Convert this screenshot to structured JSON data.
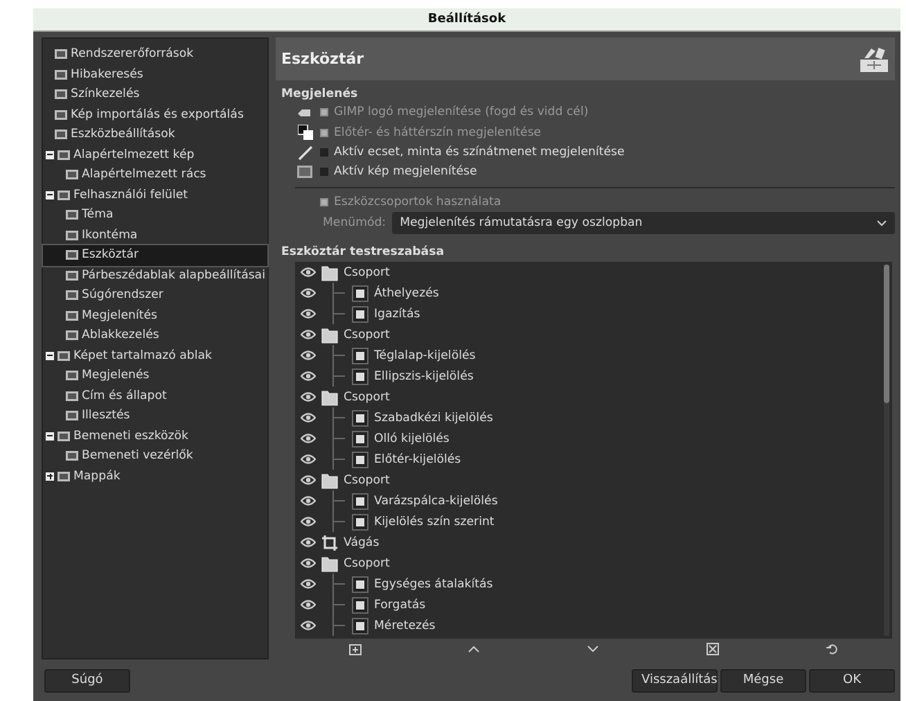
{
  "window": {
    "title": "Beállítások"
  },
  "sidebar": {
    "items": [
      {
        "label": "Rendszererőforrások",
        "selected": false
      },
      {
        "label": "Hibakeresés",
        "selected": false
      },
      {
        "label": "Színkezelés",
        "selected": false
      },
      {
        "label": "Kép importálás és exportálás",
        "selected": false
      },
      {
        "label": "Eszközbeállítások",
        "selected": false
      },
      {
        "label": "Alapértelmezett kép",
        "selected": false,
        "expanded": true,
        "children": [
          {
            "label": "Alapértelmezett rács",
            "selected": false
          }
        ]
      },
      {
        "label": "Felhasználói felület",
        "selected": false,
        "expanded": true,
        "children": [
          {
            "label": "Téma",
            "selected": false
          },
          {
            "label": "Ikontéma",
            "selected": false
          },
          {
            "label": "Eszköztár",
            "selected": true
          },
          {
            "label": "Párbeszédablak alapbeállításai",
            "selected": false
          },
          {
            "label": "Súgórendszer",
            "selected": false
          },
          {
            "label": "Megjelenítés",
            "selected": false
          },
          {
            "label": "Ablakkezelés",
            "selected": false
          }
        ]
      },
      {
        "label": "Képet tartalmazó ablak",
        "selected": false,
        "expanded": true,
        "children": [
          {
            "label": "Megjelenés",
            "selected": false
          },
          {
            "label": "Cím és állapot",
            "selected": false
          },
          {
            "label": "Illesztés",
            "selected": false
          }
        ]
      },
      {
        "label": "Bemeneti eszközök",
        "selected": false,
        "expanded": true,
        "children": [
          {
            "label": "Bemeneti vezérlők",
            "selected": false
          }
        ]
      },
      {
        "label": "Mappák",
        "selected": false,
        "expanded": false
      }
    ]
  },
  "page": {
    "title": "Eszköztár",
    "appearance": {
      "heading": "Megjelenés",
      "options": [
        {
          "label": "GIMP logó megjelenítése (fogd és vidd cél)",
          "checked": true,
          "disabled": true
        },
        {
          "label": "Előtér- és háttérszín megjelenítése",
          "checked": true,
          "disabled": true
        },
        {
          "label": "Aktív ecset, minta és színátmenet megjelenítése",
          "checked": false,
          "disabled": false
        },
        {
          "label": "Aktív kép megjelenítése",
          "checked": false,
          "disabled": false
        }
      ]
    },
    "groups_option": {
      "label": "Eszközcsoportok használata",
      "checked": true,
      "disabled": true
    },
    "menu_mode": {
      "label": "Menümód:",
      "value": "Megjelenítés rámutatásra egy oszlopban"
    },
    "customize": {
      "heading": "Eszköztár testreszabása",
      "items": [
        {
          "kind": "group",
          "label": "Csoport",
          "visible": true,
          "children": [
            {
              "kind": "tool",
              "label": "Áthelyezés",
              "visible": true
            },
            {
              "kind": "tool",
              "label": "Igazítás",
              "visible": true
            }
          ]
        },
        {
          "kind": "group",
          "label": "Csoport",
          "visible": true,
          "children": [
            {
              "kind": "tool",
              "label": "Téglalap-kijelölés",
              "visible": true
            },
            {
              "kind": "tool",
              "label": "Ellipszis-kijelölés",
              "visible": true
            }
          ]
        },
        {
          "kind": "group",
          "label": "Csoport",
          "visible": true,
          "children": [
            {
              "kind": "tool",
              "label": "Szabadkézi kijelölés",
              "visible": true
            },
            {
              "kind": "tool",
              "label": "Olló kijelölés",
              "visible": true
            },
            {
              "kind": "tool",
              "label": "Előtér-kijelölés",
              "visible": true
            }
          ]
        },
        {
          "kind": "group",
          "label": "Csoport",
          "visible": true,
          "children": [
            {
              "kind": "tool",
              "label": "Varázspálca-kijelölés",
              "visible": true
            },
            {
              "kind": "tool",
              "label": "Kijelölés szín szerint",
              "visible": true
            }
          ]
        },
        {
          "kind": "tool",
          "label": "Vágás",
          "visible": true
        },
        {
          "kind": "group",
          "label": "Csoport",
          "visible": true,
          "children": [
            {
              "kind": "tool",
              "label": "Egységes átalakítás",
              "visible": true
            },
            {
              "kind": "tool",
              "label": "Forgatás",
              "visible": true
            },
            {
              "kind": "tool",
              "label": "Méretezés",
              "visible": true
            }
          ]
        }
      ]
    }
  },
  "buttons": {
    "help": "Súgó",
    "actions": [
      "Visszaállítás",
      "Mégse",
      "OK"
    ]
  }
}
